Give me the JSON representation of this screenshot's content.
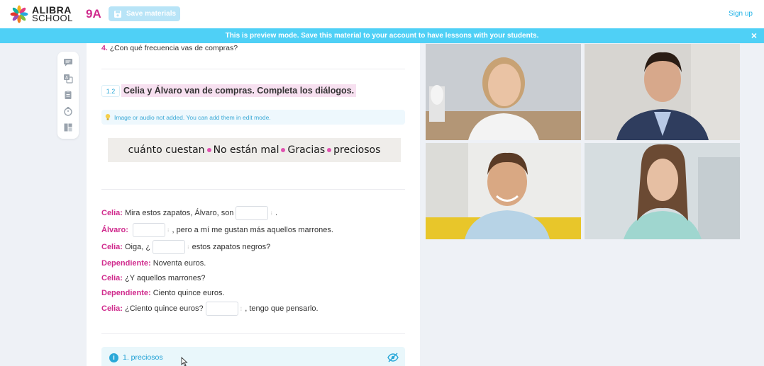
{
  "header": {
    "logo_line1": "ALIBRA",
    "logo_line2": "SCHOOL",
    "grade": "9A",
    "save_label": "Save materials",
    "signup_label": "Sign up"
  },
  "banner": {
    "text": "This is preview mode. Save this material to your account to have lessons with your students.",
    "close": "×"
  },
  "toolbar": {
    "icons": [
      "chat-icon",
      "translate-icon",
      "clipboard-icon",
      "timer-icon",
      "layout-icon"
    ]
  },
  "content": {
    "question4": {
      "num": "4.",
      "text": "¿Con qué frecuencia vas de compras?"
    },
    "section": {
      "num": "1.2",
      "title": "Celia y Álvaro van de compras. Completa los diálogos."
    },
    "notice": "Image or audio not added. You can add them in edit mode.",
    "wordbank": [
      "cuánto cuestan",
      "No están mal",
      "Gracias",
      "preciosos"
    ],
    "dialog": [
      {
        "speaker": "Celia:",
        "before": "Mira estos zapatos, Álvaro, son",
        "blank": true,
        "after": "."
      },
      {
        "speaker": "Álvaro:",
        "before": "",
        "blank": true,
        "after": ", pero a mí me gustan más aquellos marrones."
      },
      {
        "speaker": "Celia:",
        "before": "Oiga, ¿",
        "blank": true,
        "after": "estos zapatos negros?"
      },
      {
        "speaker": "Dependiente:",
        "before": "Noventa euros.",
        "blank": false,
        "after": ""
      },
      {
        "speaker": "Celia:",
        "before": "¿Y aquellos marrones?",
        "blank": false,
        "after": ""
      },
      {
        "speaker": "Dependiente:",
        "before": "Ciento quince euros.",
        "blank": false,
        "after": ""
      },
      {
        "speaker": "Celia:",
        "before": "¿Ciento quince euros?",
        "blank": true,
        "after": ", tengo que pensarlo."
      }
    ],
    "answer": {
      "icon": "i",
      "text": "1. preciosos"
    }
  },
  "videos": [
    "video-participant-1",
    "video-participant-2",
    "video-participant-3",
    "video-participant-4"
  ],
  "colors": {
    "brand_pink": "#d02b8d",
    "accent_blue": "#4fd0f6",
    "link_blue": "#1fb2e6"
  }
}
